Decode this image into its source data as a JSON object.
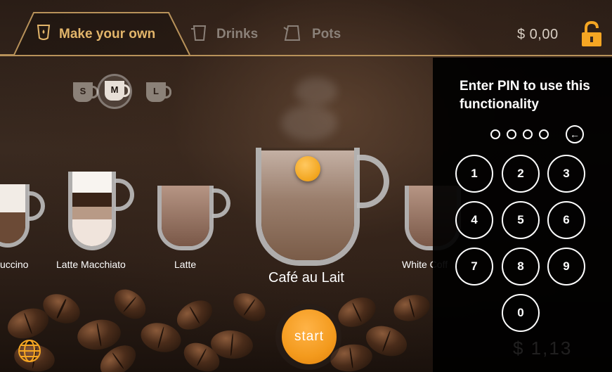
{
  "tabs": [
    {
      "label": "Make your own",
      "icon": "cup-drop-icon",
      "active": true
    },
    {
      "label": "Drinks",
      "icon": "glass-icon",
      "active": false
    },
    {
      "label": "Pots",
      "icon": "pot-icon",
      "active": false
    }
  ],
  "balance": "$ 0,00",
  "sizes": [
    "S",
    "M",
    "L"
  ],
  "selected_size": "M",
  "drinks": [
    "uccino",
    "Latte Macchiato",
    "Latte",
    "Café au Lait",
    "White Coff"
  ],
  "selected_drink": "Café au Lait",
  "start_label": "start",
  "pin": {
    "title": "Enter PIN to use this functionality",
    "digits_entered": 0,
    "digits_total": 4,
    "backspace_icon": "arrow-left-icon",
    "keys": [
      "1",
      "2",
      "3",
      "4",
      "5",
      "6",
      "7",
      "8",
      "9",
      "0"
    ]
  },
  "background_price": "$ 1,13",
  "icons": {
    "lock": "lock-icon",
    "language": "globe-icon"
  },
  "colors": {
    "accent": "#e2b56a",
    "start": "#f39a1d",
    "lock": "#f5a623"
  }
}
